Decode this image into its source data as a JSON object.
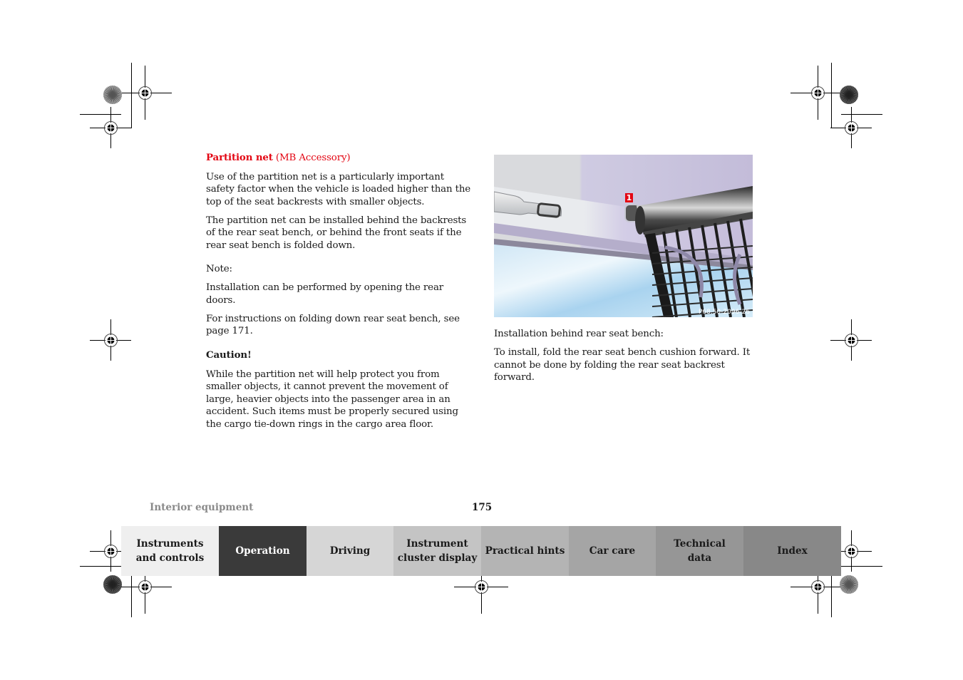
{
  "page": {
    "section_label": "Interior equipment",
    "page_number": "175"
  },
  "left_column": {
    "heading_bold": "Partition net",
    "heading_suffix": " (MB Accessory)",
    "paragraphs": [
      "Use of the partition net is a particularly important safety factor when the vehicle is loaded higher than the top of the seat backrests with smaller objects.",
      "The partition net can be installed behind the backrests of the rear seat bench, or behind the front seats if the rear seat bench is folded down."
    ],
    "note_label": "Note:",
    "note_paragraphs": [
      "Installation can be performed by opening the rear doors.",
      "For instructions on folding down rear seat bench, see page 171."
    ],
    "caution_label": "Caution!",
    "caution_text": "While the partition net will help protect you from smaller objects, it cannot prevent the movement of large, heavier objects into the passenger area in an accident. Such items must be properly secured using the cargo tie-down rings in the cargo area floor."
  },
  "figure": {
    "callout_number": "1",
    "image_code": "P68.50-2096-26",
    "description": "Partition net attached to roof mounting point near rear window"
  },
  "right_column": {
    "paragraphs": [
      "Installation behind rear seat bench:",
      "To install, fold the rear seat bench cushion forward. It cannot be done by folding the rear seat backrest forward."
    ]
  },
  "navigation": {
    "tabs": [
      {
        "label": "Instruments\nand controls",
        "bg": "#efefef",
        "fg": "#1a1a1a",
        "active": false
      },
      {
        "label": "Operation",
        "bg": "#3a3a3a",
        "fg": "#ffffff",
        "active": true
      },
      {
        "label": "Driving",
        "bg": "#d6d6d6",
        "fg": "#1a1a1a",
        "active": false
      },
      {
        "label": "Instrument\ncluster display",
        "bg": "#c4c4c4",
        "fg": "#1a1a1a",
        "active": false
      },
      {
        "label": "Practical hints",
        "bg": "#b4b4b4",
        "fg": "#1a1a1a",
        "active": false
      },
      {
        "label": "Car care",
        "bg": "#a5a5a5",
        "fg": "#1a1a1a",
        "active": false
      },
      {
        "label": "Technical\ndata",
        "bg": "#969696",
        "fg": "#1a1a1a",
        "active": false
      },
      {
        "label": "Index",
        "bg": "#888888",
        "fg": "#1a1a1a",
        "active": false
      }
    ]
  },
  "colors": {
    "heading_red": "#e30613",
    "section_label_gray": "#8a8a8a"
  }
}
